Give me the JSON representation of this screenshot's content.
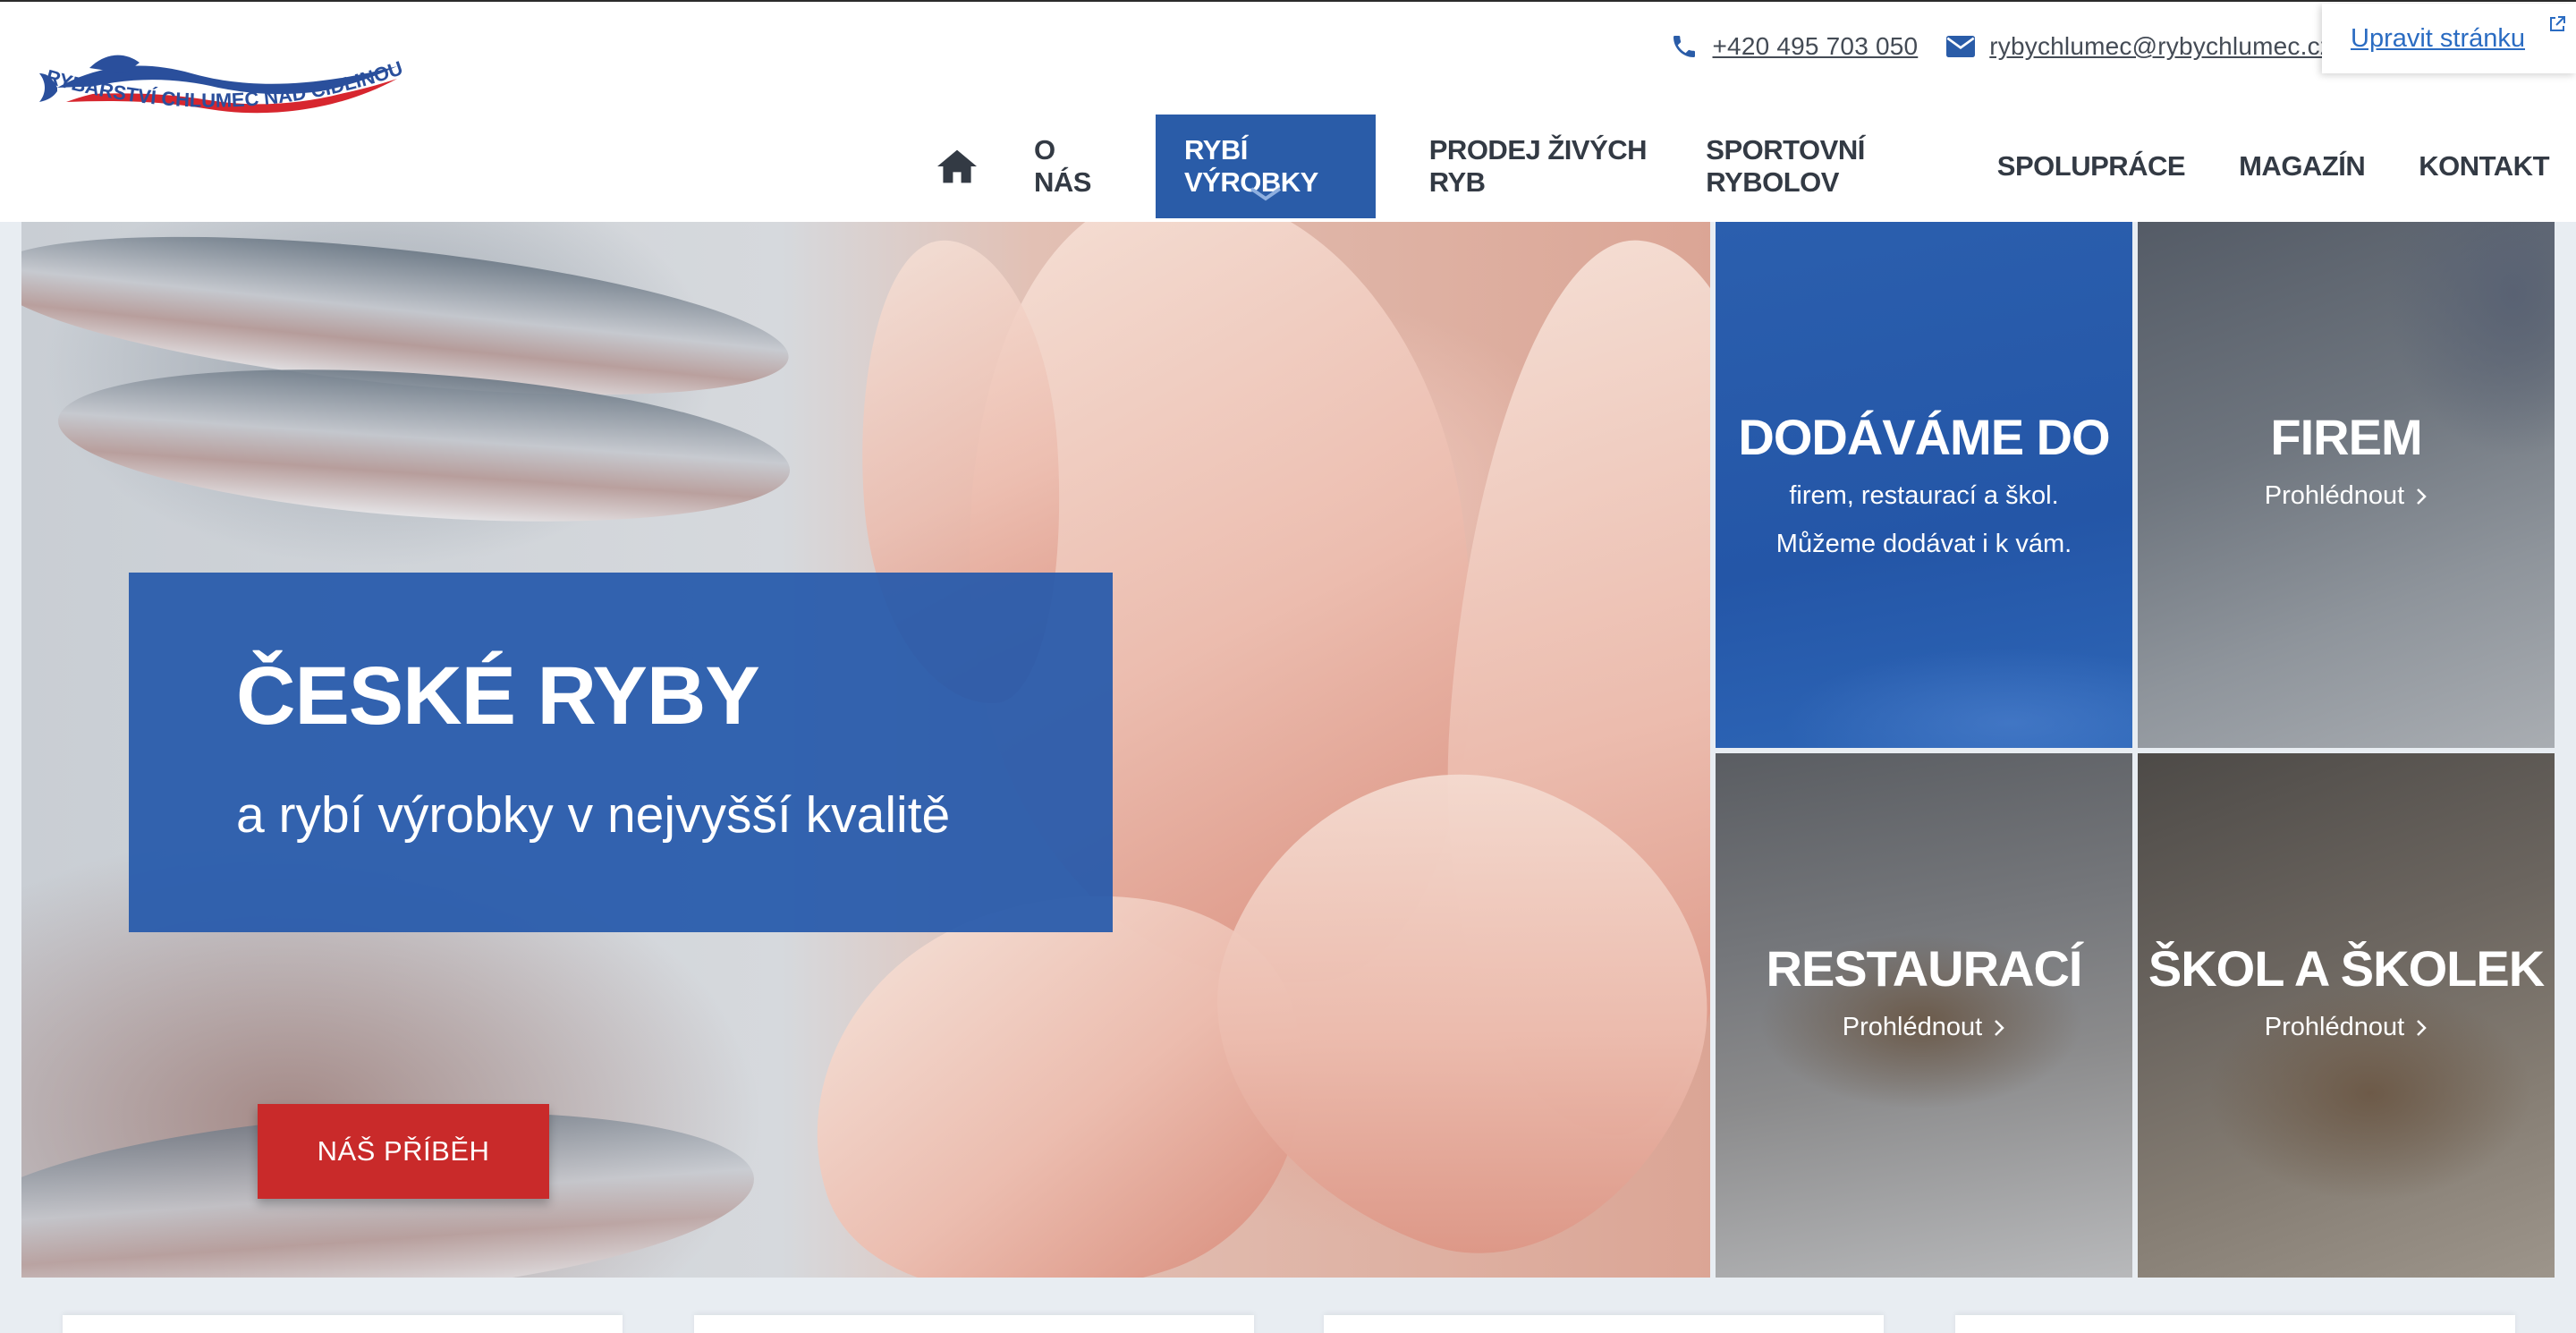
{
  "header": {
    "logo_text": "RYBÁŘSTVÍ CHLUMEC NAD CIDLINOU, a.s.",
    "phone": "+420 495 703 050",
    "email": "rybychlumec@rybychlumec.cz",
    "edit_label": "Upravit stránku"
  },
  "nav": {
    "items": [
      {
        "label": "O NÁS"
      },
      {
        "label": "RYBÍ VÝROBKY"
      },
      {
        "label": "PRODEJ ŽIVÝCH RYB"
      },
      {
        "label": "SPORTOVNÍ RYBOLOV"
      },
      {
        "label": "SPOLUPRÁCE"
      },
      {
        "label": "MAGAZÍN"
      },
      {
        "label": "KONTAKT"
      }
    ]
  },
  "hero": {
    "title": "ČESKÉ RYBY",
    "subtitle": "a rybí výrobky v nejvyšší kvalitě",
    "button": "NÁŠ PŘÍBĚH"
  },
  "tiles": {
    "intro": {
      "title": "DODÁVÁME DO",
      "line1": "firem, restaurací a škol.",
      "line2": "Můžeme dodávat i k vám."
    },
    "firem": {
      "title": "FIREM",
      "link": "Prohlédnout"
    },
    "restauraci": {
      "title": "RESTAURACÍ",
      "link": "Prohlédnout"
    },
    "skol": {
      "title": "ŠKOL A ŠKOLEK",
      "link": "Prohlédnout"
    }
  },
  "colors": {
    "brand_blue": "#2a5ca8",
    "accent_red": "#c92a2a",
    "text_dark": "#333a44",
    "link_blue": "#2b6cc2"
  }
}
